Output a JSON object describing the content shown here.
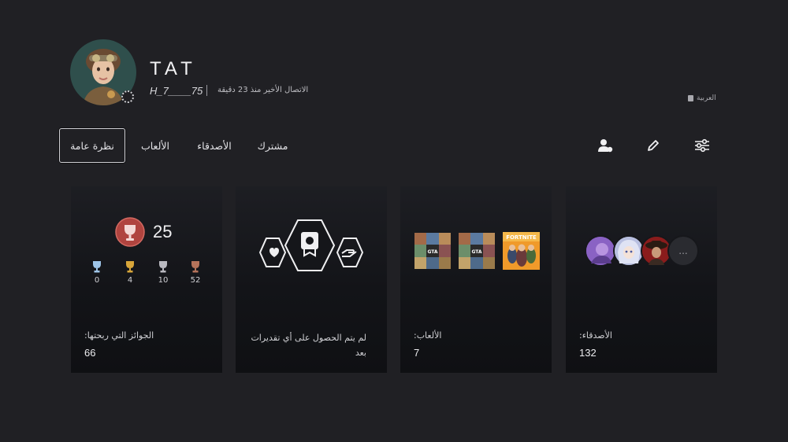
{
  "profile": {
    "name": "TAT",
    "online_id": "H_7____75",
    "last_online": "الاتصال الأخير منذ 23 دقيقة",
    "language": "العربية"
  },
  "tabs": [
    {
      "label": "نظرة عامة",
      "active": true
    },
    {
      "label": "الألعاب",
      "active": false
    },
    {
      "label": "الأصدقاء",
      "active": false
    },
    {
      "label": "مشترك",
      "active": false
    }
  ],
  "toolbar": {
    "icons": [
      "add-friend-icon",
      "edit-icon",
      "settings-sliders-icon"
    ]
  },
  "trophies": {
    "level": "25",
    "platinum": "0",
    "gold": "4",
    "silver": "10",
    "bronze": "52",
    "label": "الجوائز التي ربحتها:",
    "total": "66"
  },
  "appreciations": {
    "message_line1": "لم يتم الحصول على أي تقديرات",
    "message_line2": "بعد"
  },
  "games": {
    "label": "الألعاب:",
    "count": "7",
    "thumbs": [
      "GTA V",
      "GTA V",
      "FORTNITE"
    ]
  },
  "friends": {
    "label": "الأصدقاء:",
    "count": "132",
    "more": "..."
  },
  "colors": {
    "background": "#202024",
    "card": "#15161a",
    "level_badge": "#b0443f",
    "gold": "#d8a63a",
    "silver": "#b9b9c0",
    "bronze": "#b5735a",
    "platinum": "#9fc5e8"
  }
}
